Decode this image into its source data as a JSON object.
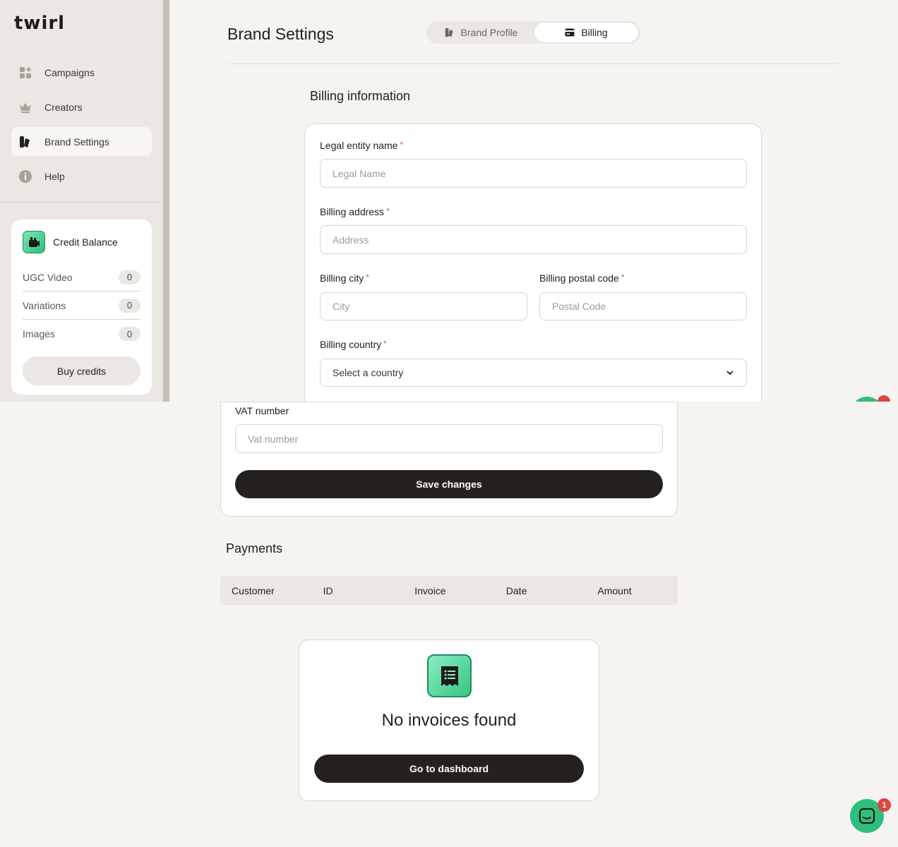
{
  "app": {
    "logo": "twirl"
  },
  "sidebar": {
    "items": [
      {
        "label": "Campaigns",
        "icon": "campaigns-icon"
      },
      {
        "label": "Creators",
        "icon": "crown-icon"
      },
      {
        "label": "Brand Settings",
        "icon": "brand-settings-icon",
        "active": true
      },
      {
        "label": "Help",
        "icon": "info-icon"
      }
    ],
    "credit": {
      "title": "Credit Balance",
      "rows": [
        {
          "label": "UGC Video",
          "count": "0"
        },
        {
          "label": "Variations",
          "count": "0"
        },
        {
          "label": "Images",
          "count": "0"
        }
      ],
      "buy_label": "Buy credits"
    }
  },
  "header": {
    "title": "Brand Settings",
    "tabs": [
      {
        "label": "Brand Profile",
        "icon": "brand-profile-icon"
      },
      {
        "label": "Billing",
        "icon": "billing-card-icon",
        "active": true
      }
    ]
  },
  "billing": {
    "title": "Billing information",
    "legal_label": "Legal entity name",
    "legal_placeholder": "Legal Name",
    "address_label": "Billing address",
    "address_placeholder": "Address",
    "city_label": "Billing city",
    "city_placeholder": "City",
    "postal_label": "Billing postal code",
    "postal_placeholder": "Postal Code",
    "country_label": "Billing country",
    "country_value": "Select a country",
    "vat_label": "VAT number",
    "vat_placeholder": "Vat number",
    "save_label": "Save changes",
    "required_mark": "*"
  },
  "payments": {
    "title": "Payments",
    "columns": [
      "Customer",
      "ID",
      "Invoice",
      "Date",
      "Amount"
    ],
    "empty_title": "No invoices found",
    "empty_button": "Go to dashboard"
  },
  "chat": {
    "badge": "1"
  },
  "colors": {
    "accent": "#2fbf7c",
    "dark": "#24211e",
    "required": "#e05353"
  }
}
